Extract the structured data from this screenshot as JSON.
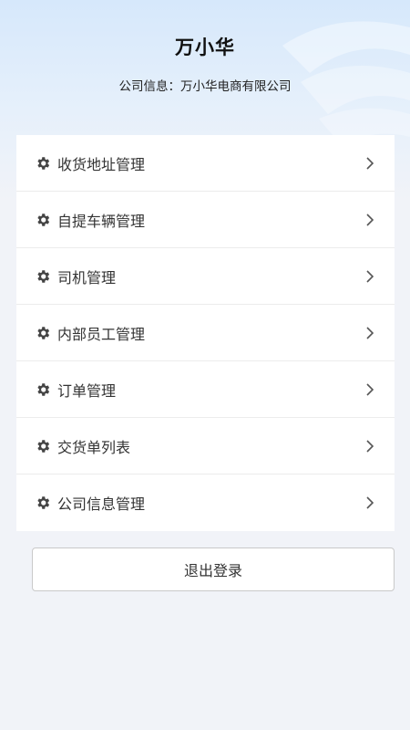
{
  "profile": {
    "name": "万小华",
    "company_label": "公司信息：",
    "company_name": "万小华电商有限公司"
  },
  "menu": [
    {
      "label": "收货地址管理",
      "icon": "gear-icon"
    },
    {
      "label": "自提车辆管理",
      "icon": "gear-icon"
    },
    {
      "label": "司机管理",
      "icon": "gear-icon"
    },
    {
      "label": "内部员工管理",
      "icon": "gear-icon"
    },
    {
      "label": "订单管理",
      "icon": "gear-icon"
    },
    {
      "label": "交货单列表",
      "icon": "gear-icon"
    },
    {
      "label": "公司信息管理",
      "icon": "gear-icon"
    }
  ],
  "logout": {
    "label": "退出登录"
  },
  "colors": {
    "header_top": "#d6e8fb",
    "page_bg": "#f1f3f8",
    "icon": "#444444",
    "chevron": "#555555"
  }
}
